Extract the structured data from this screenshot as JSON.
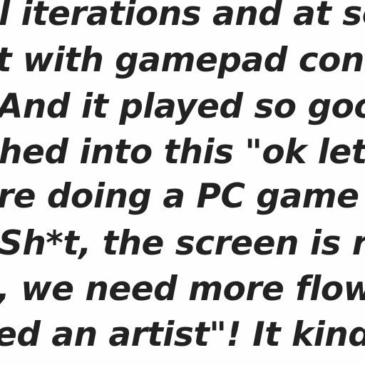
{
  "text_lines": [
    "l iterations and at sor",
    "t with gamepad contr",
    "And it played so good",
    "hed into this \"ok lets",
    "re doing a PC game w",
    "Sh*t, the screen is rea",
    ", we need more flowe",
    "ed an artist\"! It kind o"
  ]
}
